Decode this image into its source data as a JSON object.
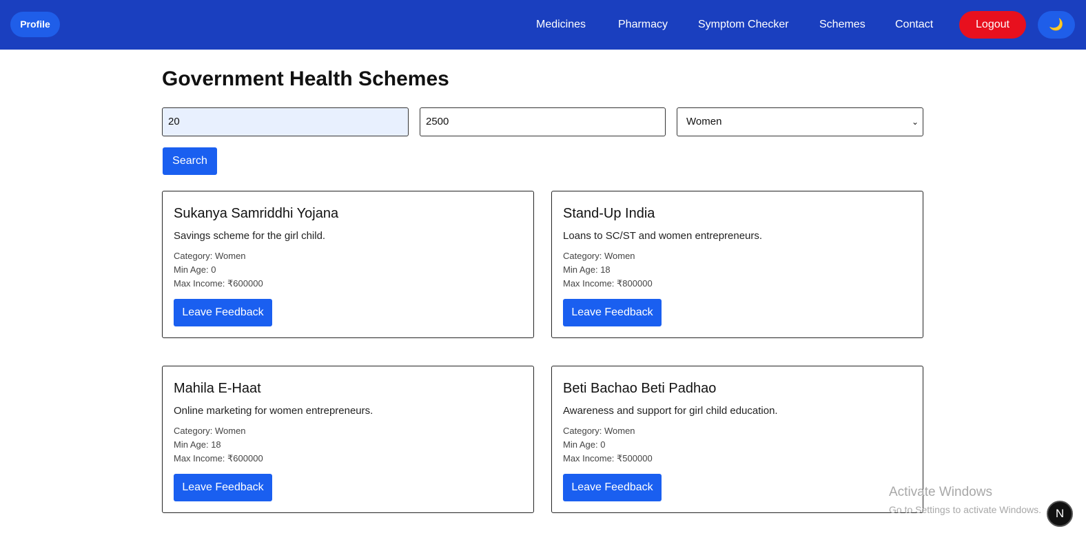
{
  "navbar": {
    "profile_label": "Profile",
    "links": [
      "Medicines",
      "Pharmacy",
      "Symptom Checker",
      "Schemes",
      "Contact"
    ],
    "logout_label": "Logout",
    "theme_icon": "moon-icon",
    "theme_glyph": "🌙"
  },
  "page": {
    "title": "Government Health Schemes"
  },
  "filters": {
    "age_value": "20",
    "income_value": "2500",
    "category_selected": "Women",
    "caret": "⌄",
    "search_label": "Search"
  },
  "schemes": [
    {
      "title": "Sukanya Samriddhi Yojana",
      "description": "Savings scheme for the girl child.",
      "category": "Category: Women",
      "min_age": "Min Age: 0",
      "max_income": "Max Income: ₹600000",
      "button": "Leave Feedback"
    },
    {
      "title": "Stand-Up India",
      "description": "Loans to SC/ST and women entrepreneurs.",
      "category": "Category: Women",
      "min_age": "Min Age: 18",
      "max_income": "Max Income: ₹800000",
      "button": "Leave Feedback"
    },
    {
      "title": "Mahila E-Haat",
      "description": "Online marketing for women entrepreneurs.",
      "category": "Category: Women",
      "min_age": "Min Age: 18",
      "max_income": "Max Income: ₹600000",
      "button": "Leave Feedback"
    },
    {
      "title": "Beti Bachao Beti Padhao",
      "description": "Awareness and support for girl child education.",
      "category": "Category: Women",
      "min_age": "Min Age: 0",
      "max_income": "Max Income: ₹500000",
      "button": "Leave Feedback"
    }
  ],
  "watermark": {
    "title": "Activate Windows",
    "subtitle": "Go to Settings to activate Windows."
  },
  "dev_badge": {
    "letter": "N"
  },
  "colors": {
    "navbar": "#1a3fbf",
    "primary_button": "#1a5ff0",
    "logout": "#e8101e",
    "autofill_field": "#e8f0fe"
  }
}
